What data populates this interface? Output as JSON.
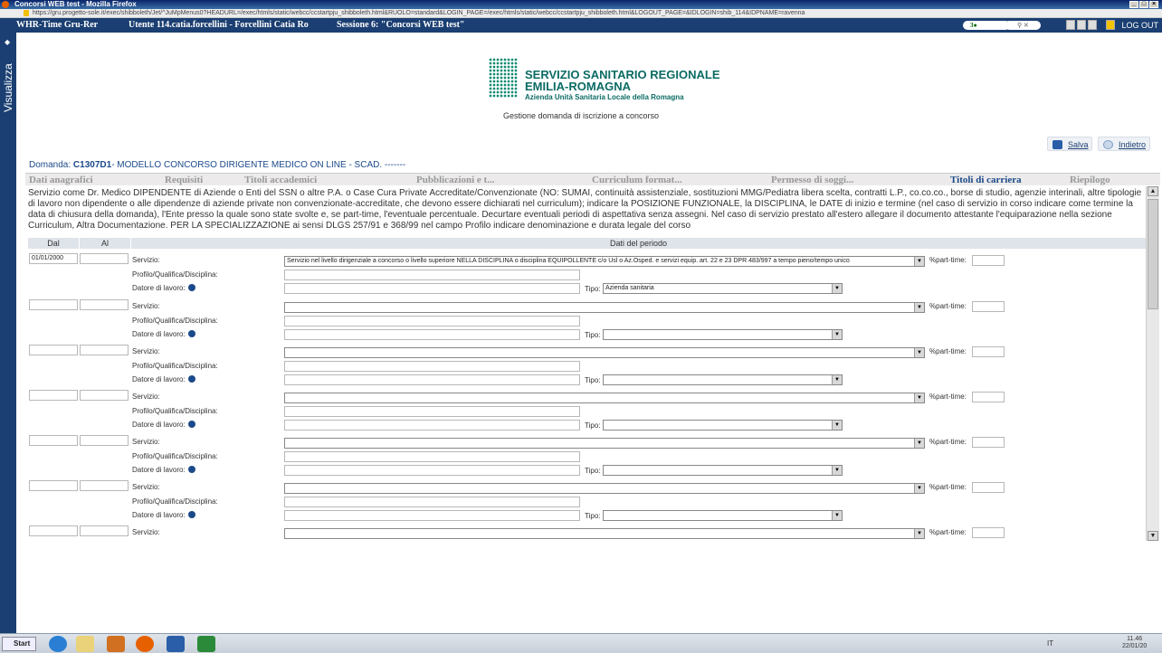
{
  "window": {
    "title": "Concorsi WEB test - Mozilla Firefox",
    "url": "https://gru.progetto-sole.it/exec/shibboleth/Jet/^JuMpMenus0?HEADURL=/exec/htmls/static/webcc/ccstartpju_shibboleth.html&RUOLO=standard&LOGIN_PAGE=/exec/htmls/static/webcc/ccstartpju_shibboleth.html&LOGOUT_PAGE=&IDLOGIN=shib_114&IDPNAME=ravenna"
  },
  "appbar": {
    "app": "WHR-Time Gru-Rer",
    "user": "Utente 114.catia.forcellini - Forcellini Catia Ro",
    "session": "Sessione 6: \"Concorsi WEB test\"",
    "pill": "3●",
    "logout": "LOG OUT"
  },
  "sidebar": {
    "label": "Visualizza",
    "arrow": "◆"
  },
  "header": {
    "org1": "SERVIZIO SANITARIO REGIONALE",
    "org2": "EMILIA-ROMAGNA",
    "org3": "Azienda Unità Sanitaria Locale della Romagna",
    "subtitle": "Gestione domanda di iscrizione a concorso"
  },
  "actions": {
    "save": "Salva",
    "back": "Indietro"
  },
  "domanda": {
    "prefix": "Domanda: ",
    "code": "C1307D1",
    "text": "- MODELLO CONCORSO DIRIGENTE MEDICO ON LINE - SCAD. -------"
  },
  "tabs": [
    "Dati anagrafici",
    "Requisiti",
    "Titoli accademici",
    "Pubblicazioni e t...",
    "Curriculum format...",
    "Permesso di soggi...",
    "Titoli di carriera",
    "Riepilogo"
  ],
  "description": "Servizio come Dr. Medico DIPENDENTE di Aziende o Enti del SSN o altre P.A. o Case Cura Private Accreditate/Convenzionate (NO: SUMAI, continuità assistenziale, sostituzioni MMG/Pediatra libera scelta, contratti L.P., co.co.co., borse di studio, agenzie interinali, altre tipologie di lavoro non dipendente o alle dipendenze di aziende private non convenzionate-accreditate, che devono essere dichiarati nel curriculum); indicare la POSIZIONE FUNZIONALE, la DISCIPLINA, le DATE di inizio e termine (nel caso di servizio in corso indicare come termine la data di chiusura della domanda), l'Ente presso la quale sono state svolte e, se part-time, l'eventuale percentuale. Decurtare eventuali periodi di aspettativa senza assegni. Nel caso di servizio prestato all'estero allegare il documento attestante l'equiparazione nella sezione Curriculum, Altra Documentazione. PER LA SPECIALIZZAZIONE ai sensi DLGS 257/91 e 368/99 nel campo Profilo indicare denominazione e durata legale del corso",
  "table": {
    "col_dal": "Dal",
    "col_al": "Al",
    "col_dati": "Dati del periodo"
  },
  "labels": {
    "servizio": "Servizio:",
    "profilo": "Profilo/Qualifica/Disciplina:",
    "datore": "Datore di lavoro:",
    "tipo": "Tipo:",
    "parttime": "%part-time:"
  },
  "rows": [
    {
      "dal": "01/01/2000",
      "al": "",
      "servizio": "Servizio nel livello dirigenziale a concorso o livello superiore NELLA DISCIPLINA o disciplina EQUIPOLLENTE c/o Usl o Az.Osped. e servizi equip. art. 22 e 23 DPR 483/997 a tempo pieno/tempo unico",
      "profilo": "",
      "datore": "",
      "tipo": "Azienda sanitaria",
      "parttime": ""
    },
    {
      "dal": "",
      "al": "",
      "servizio": "",
      "profilo": "",
      "datore": "",
      "tipo": "",
      "parttime": ""
    },
    {
      "dal": "",
      "al": "",
      "servizio": "",
      "profilo": "",
      "datore": "",
      "tipo": "",
      "parttime": ""
    },
    {
      "dal": "",
      "al": "",
      "servizio": "",
      "profilo": "",
      "datore": "",
      "tipo": "",
      "parttime": ""
    },
    {
      "dal": "",
      "al": "",
      "servizio": "",
      "profilo": "",
      "datore": "",
      "tipo": "",
      "parttime": ""
    },
    {
      "dal": "",
      "al": "",
      "servizio": "",
      "profilo": "",
      "datore": "",
      "tipo": "",
      "parttime": ""
    },
    {
      "dal": "",
      "al": "",
      "servizio": "",
      "profilo": "",
      "datore": "",
      "tipo": "",
      "parttime": ""
    }
  ],
  "taskbar": {
    "start": "Start",
    "tray": "IT",
    "time": "11.46",
    "date": "22/01/20"
  }
}
